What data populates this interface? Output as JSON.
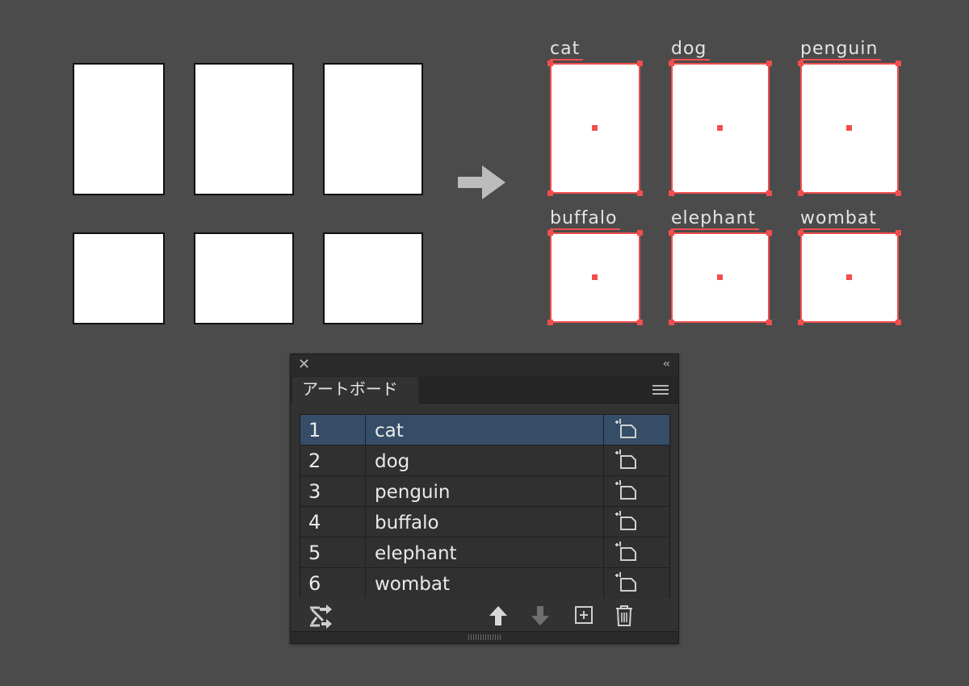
{
  "canvas": {
    "selection_color": "#f24e4e",
    "artboards_before_count": 6,
    "artboards_after": [
      {
        "label": "cat"
      },
      {
        "label": "dog"
      },
      {
        "label": "penguin"
      },
      {
        "label": "buffalo"
      },
      {
        "label": "elephant"
      },
      {
        "label": "wombat"
      }
    ]
  },
  "panel": {
    "close_icon": "close-icon",
    "collapse_icon": "collapse-icon",
    "tab_label": "アートボード",
    "menu_icon": "panel-menu-icon",
    "rows": [
      {
        "number": "1",
        "name": "cat",
        "selected": true
      },
      {
        "number": "2",
        "name": "dog"
      },
      {
        "number": "3",
        "name": "penguin"
      },
      {
        "number": "4",
        "name": "buffalo"
      },
      {
        "number": "5",
        "name": "elephant"
      },
      {
        "number": "6",
        "name": "wombat"
      }
    ],
    "toolbar_icons": [
      "rearrange-icon",
      "move-up-icon",
      "move-down-icon",
      "new-artboard-icon",
      "delete-icon"
    ],
    "selected_row_color": "#364d68"
  }
}
